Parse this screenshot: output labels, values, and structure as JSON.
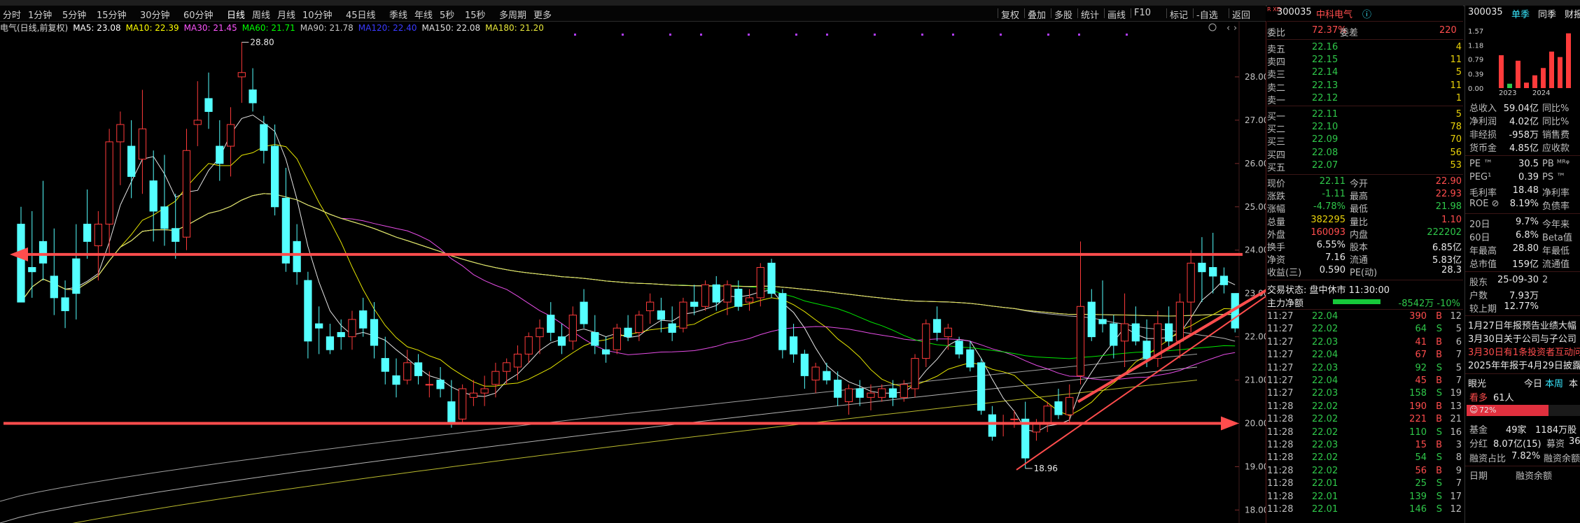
{
  "toolbar": {
    "periods": [
      "分时",
      "1分钟",
      "5分钟",
      "15分钟",
      "30分钟",
      "60分钟",
      "日线",
      "周线",
      "月线",
      "10分钟",
      "45日线",
      "季线",
      "年线",
      "5秒",
      "15秒",
      "多周期",
      "更多"
    ],
    "active_period": "日线",
    "right_items": [
      "复权",
      "叠加",
      "多股",
      "统计",
      "画线",
      "F10",
      "标记",
      "-自选",
      "返回"
    ]
  },
  "indicator": {
    "title": "电气(日线,前复权)",
    "ma": [
      {
        "label": "MA5: 23.08",
        "color": "#ffffff"
      },
      {
        "label": "MA10: 22.39",
        "color": "#ffff00"
      },
      {
        "label": "MA30: 21.45",
        "color": "#ff55ff"
      },
      {
        "label": "MA60: 21.71",
        "color": "#00ff00"
      },
      {
        "label": "MA90: 21.78",
        "color": "#c8c8c8"
      },
      {
        "label": "MA120: 22.40",
        "color": "#3a3aff"
      },
      {
        "label": "MA150: 22.08",
        "color": "#e0e0e0"
      },
      {
        "label": "MA180: 21.20",
        "color": "#e8e83a"
      }
    ]
  },
  "price_axis": {
    "ticks": [
      "28.00",
      "27.00",
      "26.00",
      "25.00",
      "24.00",
      "23.00",
      "22.00",
      "21.00",
      "20.00",
      "19.00",
      "18.00"
    ]
  },
  "chart_data": {
    "type": "candlestick",
    "ylim": [
      17.7,
      29.0
    ],
    "annotations": [
      {
        "text": "28.80",
        "value": 28.8
      },
      {
        "text": "18.96",
        "value": 18.96
      }
    ],
    "hlines": [
      23.9,
      20.0
    ],
    "candles": [
      [
        24.6,
        25.0,
        23.3,
        22.8
      ],
      [
        23.6,
        24.9,
        22.9,
        23.5
      ],
      [
        24.2,
        25.6,
        23.3,
        23.7
      ],
      [
        23.4,
        24.5,
        22.5,
        22.9
      ],
      [
        22.9,
        23.3,
        22.2,
        22.6
      ],
      [
        23.8,
        24.6,
        22.4,
        23.0
      ],
      [
        24.6,
        25.4,
        23.8,
        24.2
      ],
      [
        24.1,
        24.9,
        23.3,
        24.6
      ],
      [
        24.6,
        26.8,
        23.9,
        26.5
      ],
      [
        26.5,
        27.2,
        25.5,
        26.9
      ],
      [
        26.4,
        27.0,
        25.2,
        25.7
      ],
      [
        26.1,
        27.7,
        25.3,
        26.8
      ],
      [
        25.6,
        26.3,
        24.2,
        24.9
      ],
      [
        25.0,
        26.2,
        24.1,
        24.5
      ],
      [
        24.5,
        25.3,
        23.8,
        24.2
      ],
      [
        24.3,
        26.8,
        24.0,
        26.3
      ],
      [
        26.9,
        27.9,
        26.4,
        27.0
      ],
      [
        27.5,
        28.1,
        26.8,
        27.2
      ],
      [
        26.4,
        27.0,
        25.6,
        26.0
      ],
      [
        26.4,
        27.3,
        25.7,
        26.9
      ],
      [
        28.0,
        28.8,
        27.4,
        28.1
      ],
      [
        27.7,
        28.2,
        27.2,
        27.4
      ],
      [
        26.9,
        27.1,
        26.0,
        26.3
      ],
      [
        26.4,
        26.9,
        24.8,
        25.0
      ],
      [
        25.2,
        25.9,
        23.5,
        23.7
      ],
      [
        24.2,
        24.6,
        23.2,
        23.5
      ],
      [
        23.3,
        23.5,
        21.5,
        21.9
      ],
      [
        22.3,
        22.7,
        21.6,
        22.2
      ],
      [
        22.0,
        22.3,
        21.6,
        21.7
      ],
      [
        22.1,
        22.4,
        21.7,
        22.0
      ],
      [
        22.0,
        22.6,
        21.7,
        22.4
      ],
      [
        22.6,
        22.9,
        22.0,
        22.2
      ],
      [
        22.4,
        22.8,
        21.5,
        21.8
      ],
      [
        21.5,
        22.0,
        20.9,
        21.2
      ],
      [
        21.1,
        21.5,
        20.6,
        20.9
      ],
      [
        21.0,
        21.7,
        20.9,
        21.4
      ],
      [
        21.4,
        21.6,
        20.9,
        21.1
      ],
      [
        20.9,
        21.2,
        20.6,
        20.9
      ],
      [
        21.0,
        21.3,
        20.6,
        20.8
      ],
      [
        20.5,
        21.0,
        19.9,
        20.0
      ],
      [
        20.1,
        20.9,
        20.0,
        20.8
      ],
      [
        20.6,
        21.0,
        20.4,
        20.7
      ],
      [
        20.7,
        21.1,
        20.4,
        20.8
      ],
      [
        20.9,
        21.4,
        20.6,
        21.2
      ],
      [
        21.2,
        21.5,
        20.9,
        21.4
      ],
      [
        21.3,
        21.8,
        21.0,
        21.6
      ],
      [
        21.6,
        22.1,
        21.4,
        22.0
      ],
      [
        22.0,
        22.4,
        21.6,
        22.2
      ],
      [
        22.5,
        22.8,
        21.9,
        22.1
      ],
      [
        22.0,
        22.3,
        21.6,
        21.8
      ],
      [
        21.9,
        22.7,
        21.7,
        22.5
      ],
      [
        22.8,
        23.1,
        22.2,
        22.3
      ],
      [
        22.1,
        22.5,
        21.6,
        21.8
      ],
      [
        21.7,
        22.0,
        21.4,
        21.6
      ],
      [
        21.7,
        22.3,
        21.6,
        22.2
      ],
      [
        22.2,
        22.5,
        21.9,
        22.0
      ],
      [
        22.1,
        22.6,
        21.9,
        22.5
      ],
      [
        22.6,
        23.0,
        22.3,
        22.8
      ],
      [
        22.6,
        22.9,
        22.1,
        22.4
      ],
      [
        22.3,
        22.7,
        21.9,
        22.1
      ],
      [
        22.2,
        22.9,
        22.1,
        22.8
      ],
      [
        22.8,
        23.2,
        22.5,
        22.7
      ],
      [
        22.7,
        23.3,
        22.6,
        23.2
      ],
      [
        23.2,
        23.4,
        22.6,
        22.8
      ],
      [
        22.8,
        23.3,
        22.5,
        23.2
      ],
      [
        23.1,
        23.3,
        22.6,
        22.7
      ],
      [
        22.8,
        23.1,
        22.6,
        22.9
      ],
      [
        22.9,
        23.7,
        22.7,
        23.6
      ],
      [
        23.7,
        23.8,
        22.9,
        23.0
      ],
      [
        23.0,
        23.1,
        21.5,
        21.7
      ],
      [
        22.0,
        22.3,
        21.4,
        21.6
      ],
      [
        21.6,
        21.7,
        20.8,
        21.1
      ],
      [
        21.0,
        21.4,
        20.7,
        21.3
      ],
      [
        21.2,
        21.4,
        20.9,
        21.0
      ],
      [
        21.0,
        21.2,
        20.4,
        20.6
      ],
      [
        20.5,
        20.9,
        20.2,
        20.8
      ],
      [
        20.8,
        21.0,
        20.4,
        20.6
      ],
      [
        20.6,
        20.9,
        20.3,
        20.7
      ],
      [
        20.6,
        20.9,
        20.5,
        20.8
      ],
      [
        20.8,
        21.0,
        20.4,
        20.6
      ],
      [
        20.6,
        21.0,
        20.5,
        20.9
      ],
      [
        20.8,
        21.6,
        20.6,
        21.5
      ],
      [
        21.5,
        22.4,
        21.3,
        22.3
      ],
      [
        22.4,
        22.7,
        21.9,
        22.1
      ],
      [
        22.0,
        22.3,
        21.7,
        22.2
      ],
      [
        21.9,
        22.0,
        21.5,
        21.6
      ],
      [
        21.7,
        21.9,
        21.2,
        21.3
      ],
      [
        21.4,
        21.5,
        20.2,
        20.3
      ],
      [
        20.2,
        20.4,
        19.6,
        19.7
      ],
      [
        20.0,
        20.2,
        19.7,
        20.0
      ],
      [
        20.1,
        20.3,
        19.9,
        20.1
      ],
      [
        20.1,
        20.5,
        18.96,
        19.2
      ],
      [
        19.8,
        20.1,
        19.6,
        20.0
      ],
      [
        20.0,
        20.5,
        19.8,
        20.4
      ],
      [
        20.5,
        20.8,
        20.1,
        20.2
      ],
      [
        20.2,
        20.9,
        20.0,
        20.6
      ],
      [
        21.1,
        24.2,
        20.9,
        22.7
      ],
      [
        22.8,
        23.1,
        21.9,
        22.0
      ],
      [
        22.4,
        23.3,
        22.1,
        22.3
      ],
      [
        22.3,
        22.5,
        21.5,
        21.8
      ],
      [
        21.9,
        23.0,
        21.3,
        22.3
      ],
      [
        22.3,
        22.7,
        21.8,
        21.9
      ],
      [
        21.9,
        22.4,
        21.3,
        21.5
      ],
      [
        21.5,
        22.6,
        21.3,
        22.3
      ],
      [
        22.3,
        22.7,
        21.7,
        21.9
      ],
      [
        21.9,
        23.0,
        21.5,
        22.8
      ],
      [
        22.8,
        24.0,
        22.1,
        23.7
      ],
      [
        23.7,
        24.3,
        22.8,
        23.5
      ],
      [
        23.6,
        24.4,
        23.0,
        23.4
      ],
      [
        23.4,
        23.6,
        23.0,
        23.2
      ],
      [
        23.0,
        23.0,
        22.1,
        22.2
      ]
    ]
  },
  "quote": {
    "code_prefix": "R\nXD",
    "code": "300035",
    "name": "中科电气",
    "wei_bi_label": "委比",
    "wei_bi": "72.37%",
    "wei_cha_label": "委差",
    "wei_cha": "220",
    "asks": [
      {
        "label": "卖五",
        "price": "22.16",
        "vol": "4"
      },
      {
        "label": "卖四",
        "price": "22.15",
        "vol": "11"
      },
      {
        "label": "卖三",
        "price": "22.14",
        "vol": "5"
      },
      {
        "label": "卖二",
        "price": "22.13",
        "vol": "11"
      },
      {
        "label": "卖一",
        "price": "22.12",
        "vol": "1"
      }
    ],
    "bids": [
      {
        "label": "买一",
        "price": "22.11",
        "vol": "5"
      },
      {
        "label": "买二",
        "price": "22.10",
        "vol": "78"
      },
      {
        "label": "买三",
        "price": "22.09",
        "vol": "70"
      },
      {
        "label": "买四",
        "price": "22.08",
        "vol": "56"
      },
      {
        "label": "买五",
        "price": "22.07",
        "vol": "53"
      }
    ],
    "stats": [
      {
        "l1": "现价",
        "v1": "22.11",
        "l2": "今开",
        "v2": "22.90",
        "c1": "green",
        "c2": "red"
      },
      {
        "l1": "涨跌",
        "v1": "-1.11",
        "l2": "最高",
        "v2": "22.93",
        "c1": "green",
        "c2": "red"
      },
      {
        "l1": "涨幅",
        "v1": "-4.78%",
        "l2": "最低",
        "v2": "21.98",
        "c1": "green",
        "c2": "green"
      },
      {
        "l1": "总量",
        "v1": "382295",
        "l2": "量比",
        "v2": "1.10",
        "c1": "yellow",
        "c2": "red"
      },
      {
        "l1": "外盘",
        "v1": "160093",
        "l2": "内盘",
        "v2": "222202",
        "c1": "red",
        "c2": "green"
      },
      {
        "l1": "换手",
        "v1": "6.55%",
        "l2": "股本",
        "v2": "6.85亿",
        "c1": "white",
        "c2": "white"
      },
      {
        "l1": "净资",
        "v1": "7.16",
        "l2": "流通",
        "v2": "5.83亿",
        "c1": "white",
        "c2": "white"
      },
      {
        "l1": "收益(三)",
        "v1": "0.590",
        "l2": "PE(动)",
        "v2": "28.3",
        "c1": "white",
        "c2": "white"
      }
    ],
    "trade_status": "交易状态: 盘中休市 11:30:00",
    "main_flow_label": "主力净额",
    "main_flow_value": "-8542万 -10%",
    "ticks": [
      {
        "t": "11:27",
        "p": "22.04",
        "v": "390",
        "s": "B",
        "n": "12"
      },
      {
        "t": "11:27",
        "p": "22.02",
        "v": "64",
        "s": "S",
        "n": "5"
      },
      {
        "t": "11:27",
        "p": "22.03",
        "v": "41",
        "s": "B",
        "n": "6"
      },
      {
        "t": "11:27",
        "p": "22.04",
        "v": "67",
        "s": "B",
        "n": "7"
      },
      {
        "t": "11:27",
        "p": "22.03",
        "v": "92",
        "s": "S",
        "n": "5"
      },
      {
        "t": "11:27",
        "p": "22.04",
        "v": "45",
        "s": "B",
        "n": "7"
      },
      {
        "t": "11:27",
        "p": "22.03",
        "v": "158",
        "s": "S",
        "n": "19"
      },
      {
        "t": "11:28",
        "p": "22.02",
        "v": "190",
        "s": "B",
        "n": "13"
      },
      {
        "t": "11:28",
        "p": "22.02",
        "v": "221",
        "s": "B",
        "n": "21"
      },
      {
        "t": "11:28",
        "p": "22.02",
        "v": "110",
        "s": "S",
        "n": "16"
      },
      {
        "t": "11:28",
        "p": "22.03",
        "v": "15",
        "s": "B",
        "n": "3"
      },
      {
        "t": "11:28",
        "p": "22.02",
        "v": "54",
        "s": "S",
        "n": "8"
      },
      {
        "t": "11:28",
        "p": "22.02",
        "v": "56",
        "s": "B",
        "n": "9"
      },
      {
        "t": "11:28",
        "p": "22.01",
        "v": "25",
        "s": "S",
        "n": "7"
      },
      {
        "t": "11:28",
        "p": "22.01",
        "v": "139",
        "s": "S",
        "n": "17"
      },
      {
        "t": "11:28",
        "p": "22.01",
        "v": "146",
        "s": "S",
        "n": "12"
      }
    ]
  },
  "fundamentals": {
    "code": "300035",
    "tab1": "单季",
    "tab2": "同季",
    "tab3": "财报",
    "mini_yticks": [
      "1.57",
      "1.18",
      "0.79",
      "0.39",
      "0.00"
    ],
    "mini_xticks": [
      "2023",
      "2024"
    ],
    "mini_bars": [
      {
        "value": 0.9,
        "color": "#ff3b3b"
      },
      {
        "value": 0.12,
        "color": "#2fc84a"
      },
      {
        "value": 0.75,
        "color": "#ff3b3b"
      },
      {
        "value": 0.15,
        "color": "#ff3b3b"
      },
      {
        "value": 0.35,
        "color": "#ff3b3b"
      },
      {
        "value": 0.55,
        "color": "#ff3b3b"
      },
      {
        "value": 1.0,
        "color": "#ff3b3b"
      },
      {
        "value": 0.85,
        "color": "#ff3b3b"
      },
      {
        "value": 1.5,
        "color": "#ff3b3b"
      }
    ],
    "rows1": [
      {
        "l": "总收入",
        "v": "59.04亿",
        "r": "同比%"
      },
      {
        "l": "净利润",
        "v": "4.02亿",
        "r": "同比%"
      },
      {
        "l": "非经损",
        "v": "-958万",
        "r": "销售费"
      },
      {
        "l": "货币金",
        "v": "4.85亿",
        "r": "应收款"
      }
    ],
    "rows2": [
      {
        "l": "PE ™",
        "v": "30.5",
        "r": "PB ᴹᴿᵠ"
      },
      {
        "l": "PEG¹",
        "v": "0.39",
        "r": "PS ™"
      },
      {
        "l": "毛利率",
        "v": "18.48",
        "r": "净利率"
      },
      {
        "l": "ROE ⊘",
        "v": "8.19%",
        "r": "负债率"
      }
    ],
    "rows3": [
      {
        "l": "20日",
        "v": "9.7%",
        "r": "今年来"
      },
      {
        "l": "60日",
        "v": "6.8%",
        "r": "Beta值"
      },
      {
        "l": "年最高",
        "v": "28.80",
        "r": "年最低"
      },
      {
        "l": "总市值",
        "v": "159亿",
        "r": "流通值"
      }
    ],
    "rows4": [
      {
        "l": "股东",
        "v": "25-09-30",
        "r": "2"
      },
      {
        "l": "户数",
        "v": "7.93万",
        "r": ""
      },
      {
        "l": "较上期",
        "v": "12.77%",
        "r": ""
      }
    ],
    "news": [
      {
        "text": "1月27日年报预告业绩大幅",
        "color": "#e8e8e8"
      },
      {
        "text": "3月30日关于公司与子公司",
        "color": "#e8e8e8"
      },
      {
        "text": "3月30日有1条投资者互动问",
        "color": "#ff4d4d"
      },
      {
        "text": "2025年年报于4月29日披露",
        "color": "#e8e8e8"
      }
    ],
    "sentiment_label": "眼光",
    "sentiment_tab1": "今日",
    "sentiment_tab2": "本周",
    "sentiment_tab3": "本",
    "bull_label": "看多",
    "bull_count": "61人",
    "bull_pct": "72%",
    "bull_fraction": 0.72,
    "fund_label": "基金",
    "fund_count": "49家",
    "fund_shares": "1184万股",
    "fenhong_label": "分红",
    "fenhong_value": "8.07亿(15)",
    "mu_zi_label": "募资",
    "mu_zi_value": "36",
    "rzzb_label": "融资占比",
    "rzzb_value": "7.82%",
    "rzye_label": "融资余额",
    "bottom_l1": "日期",
    "bottom_l2": "融资余额"
  }
}
